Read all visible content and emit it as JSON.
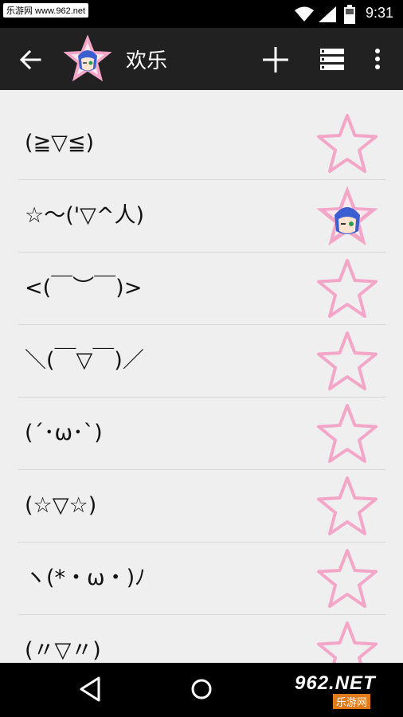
{
  "status_bar": {
    "time": "9:31",
    "watermark": "乐游网 www.962.net"
  },
  "app_bar": {
    "title": "欢乐"
  },
  "list": {
    "items": [
      {
        "text": "(≧▽≦)",
        "favorited": false
      },
      {
        "text": "☆～('▽^人)",
        "favorited": true
      },
      {
        "text": "<(￣︶￣)>",
        "favorited": false
      },
      {
        "text": "＼(￣▽￣)／",
        "favorited": false
      },
      {
        "text": "(´･ω･`)",
        "favorited": false
      },
      {
        "text": "(☆▽☆)",
        "favorited": false
      },
      {
        "text": "ヽ(*・ω・)ﾉ",
        "favorited": false
      },
      {
        "text": "(〃▽〃)",
        "favorited": false
      }
    ]
  },
  "watermark_logo": {
    "main": "962.NET",
    "sub": "乐游网"
  },
  "colors": {
    "star_pink": "#f4a6c8",
    "app_bar": "#212121",
    "content_bg": "#efefef"
  }
}
